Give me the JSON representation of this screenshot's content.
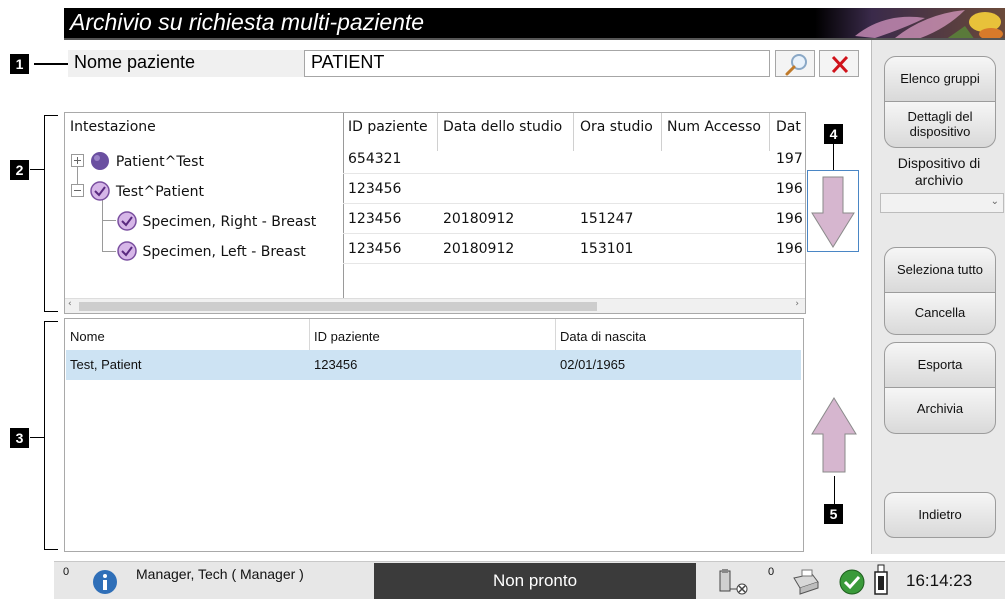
{
  "window": {
    "title": "Archivio su richiesta multi-paziente"
  },
  "search": {
    "field_selected": "Nome paziente",
    "query": "PATIENT"
  },
  "tree": {
    "columns": [
      "Intestazione",
      "ID paziente",
      "Data dello studio",
      "Ora studio",
      "Num Accesso",
      "Dat"
    ],
    "rows": [
      {
        "label": "Patient^Test",
        "id": "654321",
        "date": "",
        "time": "",
        "access": "",
        "dob": "197"
      },
      {
        "label": "Test^Patient",
        "id": "123456",
        "date": "",
        "time": "",
        "access": "",
        "dob": "196"
      },
      {
        "label": "Specimen, Right - Breast",
        "id": "123456",
        "date": "20180912",
        "time": "151247",
        "access": "",
        "dob": "196"
      },
      {
        "label": "Specimen, Left - Breast",
        "id": "123456",
        "date": "20180912",
        "time": "153101",
        "access": "",
        "dob": "196"
      }
    ]
  },
  "selected_table": {
    "columns": [
      "Nome",
      "ID paziente",
      "Data di nascita"
    ],
    "rows": [
      {
        "name": "Test, Patient",
        "id": "123456",
        "dob": "02/01/1965"
      }
    ]
  },
  "callouts": [
    "1",
    "2",
    "3",
    "4",
    "5"
  ],
  "right_panel": {
    "elenco_gruppi": "Elenco gruppi",
    "dettagli_dispositivo": "Dettagli del dispositivo",
    "dispositivo_label": "Dispositivo di archivio",
    "seleziona_tutto": "Seleziona tutto",
    "cancella": "Cancella",
    "esporta": "Esporta",
    "archivia": "Archivia",
    "indietro": "Indietro"
  },
  "status": {
    "count_left": "0",
    "user": "Manager, Tech ( Manager )",
    "state": "Non pronto",
    "count_right": "0",
    "time": "16:14:23"
  },
  "colors": {
    "selection": "#cde3f3",
    "arrow": "#d6b6cf",
    "clear_icon": "#d0131b",
    "status_dark": "#3b3b3b"
  }
}
